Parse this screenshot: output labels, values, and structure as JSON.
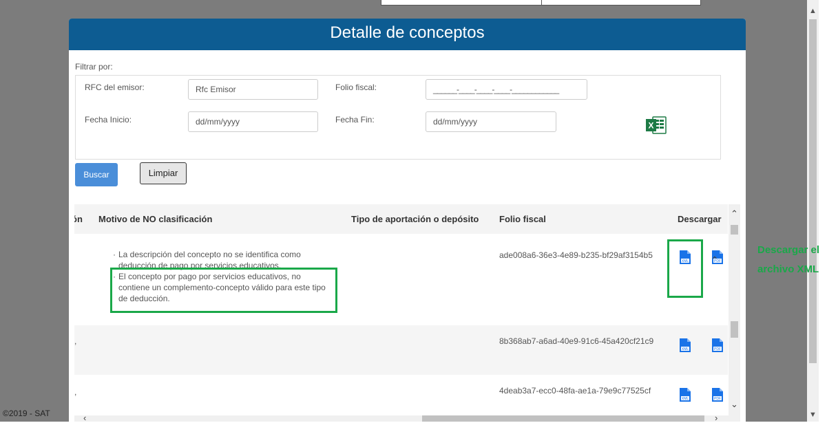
{
  "modal": {
    "title": "Detalle de conceptos"
  },
  "filter": {
    "title": "Filtrar por:",
    "rfc_label": "RFC del emisor:",
    "rfc_placeholder": "Rfc Emisor",
    "folio_label": "Folio fiscal:",
    "folio_placeholder": "______-____-____-____-____________",
    "fecha_inicio_label": "Fecha Inicio:",
    "fecha_inicio_placeholder": "dd/mm/yyyy",
    "fecha_fin_label": "Fecha Fin:",
    "fecha_fin_placeholder": "dd/mm/yyyy",
    "excel_icon": "excel-export-icon"
  },
  "buttons": {
    "buscar": "Buscar",
    "limpiar": "Limpiar"
  },
  "table": {
    "headers": {
      "partial": "ón",
      "motivo": "Motivo de NO clasificación",
      "tipo": "Tipo de aportación o depósito",
      "folio": "Folio fiscal",
      "descargar": "Descargar"
    },
    "rows": [
      {
        "partial": "",
        "motivos": [
          "La descripción del concepto no se identifica como deducción de pago por servicios educativos.",
          "El concepto por pago por servicios educativos, no contiene un complemento-concepto válido para este tipo de deducción."
        ],
        "folio": "ade008a6-36e3-4e89-b235-bf29af3154b5"
      },
      {
        "partial": "s,",
        "motivos": [],
        "folio": "8b368ab7-a6ad-40e9-91c6-45a420cf21c9"
      },
      {
        "partial": "s,",
        "motivos": [],
        "folio": "4deab3a7-ecc0-48fa-ae1a-79e9c77525cf"
      }
    ],
    "download_icons": {
      "xml": "XML",
      "pdf": "PDF"
    }
  },
  "callout": {
    "line1": "Descargar el",
    "line2": "archivo XML"
  },
  "footer": {
    "text": "©2019 - SAT"
  },
  "colors": {
    "header": "#0d5c92",
    "primary_button": "#4a8ed9",
    "highlight": "#1aa849",
    "file_icon": "#1a73e8",
    "excel": "#1d7a45"
  }
}
